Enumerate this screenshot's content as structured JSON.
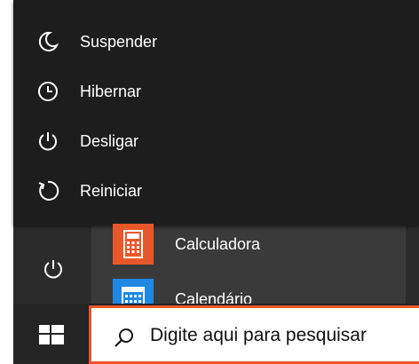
{
  "power_menu": {
    "items": [
      {
        "label": "Suspender",
        "icon": "moon-icon"
      },
      {
        "label": "Hibernar",
        "icon": "clock-icon"
      },
      {
        "label": "Desligar",
        "icon": "power-icon"
      },
      {
        "label": "Reiniciar",
        "icon": "restart-icon"
      }
    ]
  },
  "rail": {
    "power_icon": "power-icon"
  },
  "apps": [
    {
      "label": "Calculadora",
      "icon": "calculator-icon",
      "color": "#e8572a"
    },
    {
      "label": "Calendário",
      "icon": "calendar-icon",
      "color": "#1e88e5"
    }
  ],
  "taskbar": {
    "start_icon": "windows-logo-icon",
    "search": {
      "placeholder": "Digite aqui para pesquisar",
      "icon": "search-icon",
      "accent": "#e8572a"
    }
  }
}
